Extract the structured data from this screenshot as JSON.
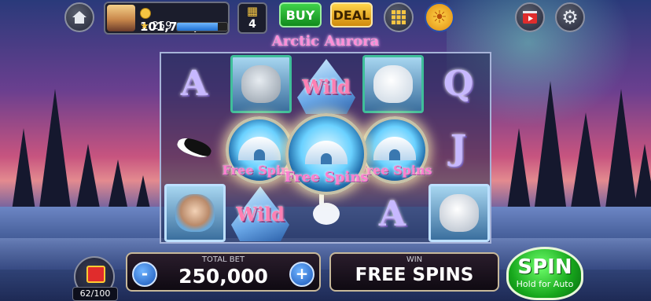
{
  "player": {
    "coins": "101,790,000",
    "level": "259",
    "xp_fraction": 0.82
  },
  "bonus": {
    "count": "4"
  },
  "buttons": {
    "buy": "BUY",
    "deal": "DEAL"
  },
  "game": {
    "title": "Arctic Aurora"
  },
  "reels": {
    "r1": {
      "letter": "A"
    },
    "r2": {
      "wild": "Wild"
    },
    "r3": {
      "wild": "Wild"
    },
    "r4": {
      "letter": "A"
    },
    "r5": {
      "letter_q": "Q",
      "letter_j": "J"
    },
    "scatter_label": "Free Spins"
  },
  "gift": {
    "progress": "62/100"
  },
  "bet": {
    "label": "TOTAL BET",
    "value": "250,000",
    "minus": "-",
    "plus": "+"
  },
  "win": {
    "label": "WIN",
    "value": "FREE SPINS"
  },
  "spin": {
    "label": "SPIN",
    "sub": "Hold for Auto"
  },
  "icons": [
    "home-icon",
    "grid-menu-icon",
    "sun-icon",
    "video-icon",
    "gear-icon",
    "trophy-icon",
    "gift-icon"
  ]
}
